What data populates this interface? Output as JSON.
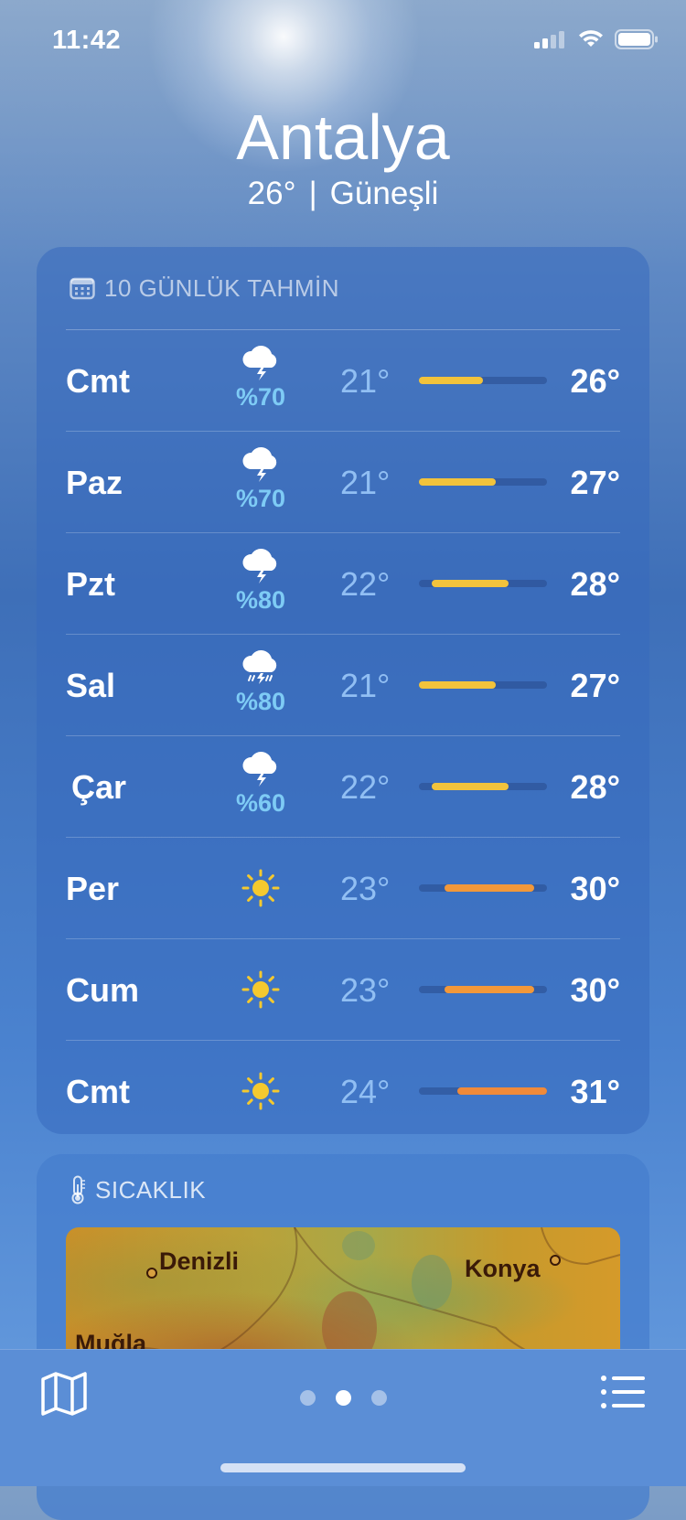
{
  "status_bar": {
    "time": "11:42",
    "icons": [
      "cellular-signal-icon",
      "wifi-icon",
      "battery-icon"
    ]
  },
  "location": {
    "city": "Antalya",
    "temperature": "26°",
    "separator": "|",
    "condition": "Güneşli"
  },
  "forecast": {
    "title": "10 GÜNLÜK TAHMİN",
    "icon": "calendar-icon",
    "scale": {
      "min": 21,
      "max": 31
    },
    "days": [
      {
        "day": "Cmt",
        "icon": "thunderstorm-icon",
        "precip": "%70",
        "low": "21°",
        "high": "26°",
        "low_value": 21,
        "high_value": 26,
        "color": "#f2c33c"
      },
      {
        "day": "Paz",
        "icon": "thunderstorm-icon",
        "precip": "%70",
        "low": "21°",
        "high": "27°",
        "low_value": 21,
        "high_value": 27,
        "color": "#f2c33c"
      },
      {
        "day": "Pzt",
        "icon": "thunderstorm-icon",
        "precip": "%80",
        "low": "22°",
        "high": "28°",
        "low_value": 22,
        "high_value": 28,
        "color": "#f2c33c"
      },
      {
        "day": "Sal",
        "icon": "thunderstorm-rain-icon",
        "precip": "%80",
        "low": "21°",
        "high": "27°",
        "low_value": 21,
        "high_value": 27,
        "color": "#f2c33c"
      },
      {
        "day": "Çar",
        "icon": "thunderstorm-icon",
        "precip": "%60",
        "low": "22°",
        "high": "28°",
        "low_value": 22,
        "high_value": 28,
        "color": "#f2c33c"
      },
      {
        "day": "Per",
        "icon": "sun-icon",
        "precip": "",
        "low": "23°",
        "high": "30°",
        "low_value": 23,
        "high_value": 30,
        "color": "#f2983a"
      },
      {
        "day": "Cum",
        "icon": "sun-icon",
        "precip": "",
        "low": "23°",
        "high": "30°",
        "low_value": 23,
        "high_value": 30,
        "color": "#f2983a"
      },
      {
        "day": "Cmt",
        "icon": "sun-icon",
        "precip": "",
        "low": "24°",
        "high": "31°",
        "low_value": 24,
        "high_value": 31,
        "color": "#f08a3a"
      }
    ]
  },
  "temperature_map": {
    "title": "SICAKLIK",
    "icon": "thermometer-icon",
    "labels": {
      "city1": "Denizli",
      "city2": "Konya",
      "city3": "Muğla"
    }
  },
  "bottom_bar": {
    "left_icon": "map-icon",
    "right_icon": "list-icon",
    "pages": 3,
    "active_page": 2
  }
}
